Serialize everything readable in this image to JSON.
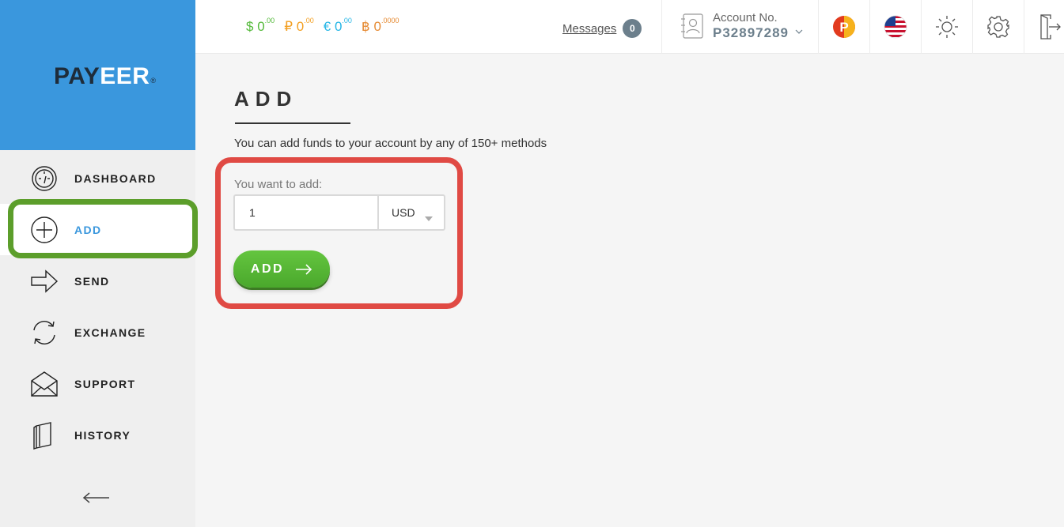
{
  "brand": {
    "logo_pay": "PAY",
    "logo_eer": "EER",
    "logo_reg": "®",
    "color": "#3a97dd"
  },
  "sidebar": {
    "items": [
      {
        "label": "DASHBOARD",
        "icon": "dashboard-gauge-icon"
      },
      {
        "label": "ADD",
        "icon": "plus-circle-icon",
        "active": true
      },
      {
        "label": "SEND",
        "icon": "arrow-right-outline-icon"
      },
      {
        "label": "EXCHANGE",
        "icon": "exchange-arrows-icon"
      },
      {
        "label": "SUPPORT",
        "icon": "envelope-icon"
      },
      {
        "label": "HISTORY",
        "icon": "book-icon"
      }
    ],
    "collapse_icon": "arrow-left-icon"
  },
  "topbar": {
    "balances": [
      {
        "symbol": "$",
        "int": "0",
        "dec": ".00",
        "color": "#54b93a"
      },
      {
        "symbol": "₽",
        "int": "0",
        "dec": ".00",
        "color": "#f3a023"
      },
      {
        "symbol": "€",
        "int": "0",
        "dec": ".00",
        "color": "#26b6e6"
      },
      {
        "symbol": "฿",
        "int": "0",
        "dec": ".0000",
        "color": "#e68b34"
      }
    ],
    "messages_label": "Messages",
    "messages_count": "0",
    "account_label": "Account No.",
    "account_number": "P32897289",
    "icons": [
      "payeer-p-icon",
      "us-flag-icon",
      "sun-brightness-icon",
      "gear-icon",
      "logout-door-icon"
    ]
  },
  "main": {
    "title": "ADD",
    "subtitle": "You can add funds to your account by any of 150+ methods",
    "field_label": "You want to add:",
    "amount_value": "1",
    "currency": "USD",
    "add_button_label": "ADD"
  },
  "colors": {
    "highlight_green": "#5c9e2b",
    "highlight_red": "#e04a44",
    "button_green": "#54b93a"
  }
}
